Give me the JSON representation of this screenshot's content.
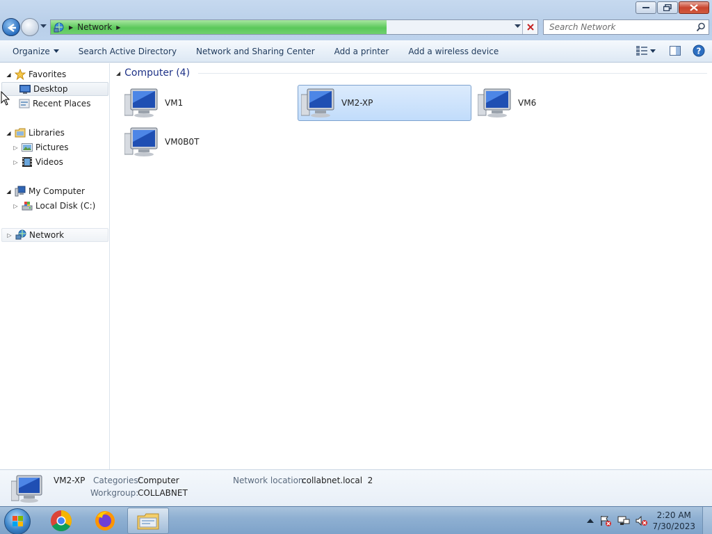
{
  "window": {
    "controls": {
      "minimize": "minimize",
      "restore": "restore",
      "close": "close"
    }
  },
  "address": {
    "path": [
      "Network"
    ],
    "progress_percent": 69
  },
  "search": {
    "placeholder": "Search Network"
  },
  "commandbar": {
    "items": [
      {
        "label": "Organize",
        "has_dropdown": true
      },
      {
        "label": "Search Active Directory"
      },
      {
        "label": "Network and Sharing Center"
      },
      {
        "label": "Add a printer"
      },
      {
        "label": "Add a wireless device"
      }
    ],
    "right_icons": [
      "change-view-icon",
      "preview-pane-icon",
      "help-icon"
    ]
  },
  "navpane": {
    "items": [
      {
        "label": "Favorites",
        "icon": "star-icon",
        "expanded": true
      },
      {
        "label": "Desktop",
        "icon": "desktop-icon",
        "selected": true
      },
      {
        "label": "Recent Places",
        "icon": "recent-places-icon"
      },
      {
        "label": "Libraries",
        "icon": "libraries-icon",
        "expanded": true
      },
      {
        "label": "Pictures",
        "icon": "pictures-icon"
      },
      {
        "label": "Videos",
        "icon": "videos-icon"
      },
      {
        "label": "My Computer",
        "icon": "computer-icon",
        "expanded": true
      },
      {
        "label": "Local Disk (C:)",
        "icon": "disk-icon"
      },
      {
        "label": "Network",
        "icon": "network-icon"
      }
    ]
  },
  "content": {
    "group_title": "Computer (4)",
    "computers": [
      {
        "name": "VM1"
      },
      {
        "name": "VM2-XP",
        "selected": true
      },
      {
        "name": "VM6"
      },
      {
        "name": "VM0B0T"
      }
    ]
  },
  "details": {
    "name": "VM2-XP",
    "categories_label": "Categories:",
    "categories_value": "Computer",
    "workgroup_label": "Workgroup:",
    "workgroup_value": "COLLABNET",
    "network_location_label": "Network location:",
    "network_location_value": "collabnet.local  2"
  },
  "taskbar": {
    "apps": [
      "chrome-icon",
      "firefox-icon",
      "explorer-icon"
    ],
    "time": "2:20 AM",
    "date": "7/30/2023"
  },
  "colors": {
    "selection": "#c1dcfb",
    "progress": "#5ac85a",
    "group_title": "#1e3287"
  }
}
